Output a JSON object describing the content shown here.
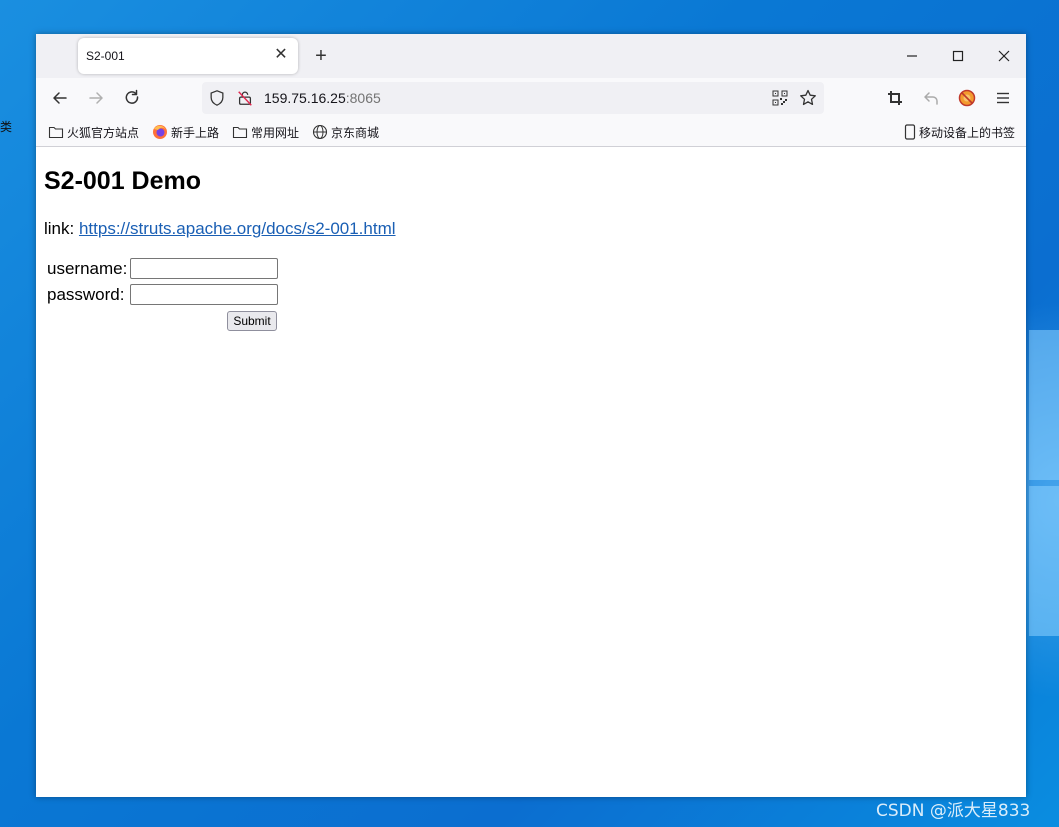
{
  "desktop": {
    "side_char": "类",
    "watermark": "CSDN @派大星833"
  },
  "browser": {
    "tab_title": "S2-001",
    "new_tab_symbol": "+",
    "url_host": "159.75.16.25",
    "url_port": ":8065"
  },
  "bookmarks": {
    "items": [
      {
        "label": "火狐官方站点",
        "icon": "folder-icon"
      },
      {
        "label": "新手上路",
        "icon": "firefox-icon"
      },
      {
        "label": "常用网址",
        "icon": "folder-icon"
      },
      {
        "label": "京东商城",
        "icon": "globe-icon"
      }
    ],
    "mobile_label": "移动设备上的书签"
  },
  "page": {
    "heading": "S2-001 Demo",
    "link_prefix": "link:",
    "link_text": "https://struts.apache.org/docs/s2-001.html",
    "username_label": "username:",
    "password_label": "password:",
    "username_value": "",
    "password_value": "",
    "submit_label": "Submit"
  }
}
